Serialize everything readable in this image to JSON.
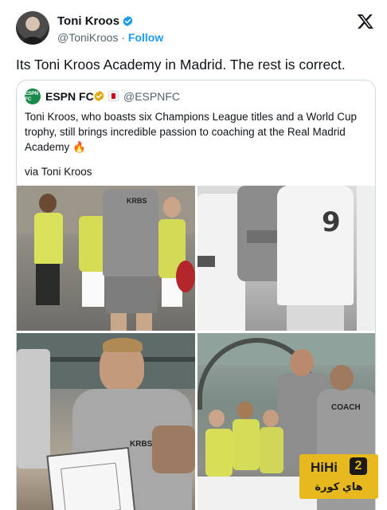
{
  "tweet": {
    "author_name": "Toni Kroos",
    "author_handle": "@ToniKroos",
    "separator": "·",
    "follow_label": "Follow",
    "text": "Its Toni Kroos Academy in Madrid. The rest is correct."
  },
  "quoted_tweet": {
    "author_name": "ESPN FC",
    "logo_text": "ESPN FC",
    "author_handle": "@ESPNFC",
    "body": "Toni Kroos, who boasts six Champions League titles and a World Cup trophy, still brings incredible passion to coaching at the Real Madrid Academy 🔥",
    "via": "via Toni Kroos"
  },
  "photos": {
    "top_left_shirt": "KRBS",
    "top_right_number": "9",
    "bottom_left_shirt": "KRBS",
    "bottom_right_shirt": "COACH"
  },
  "watermark": {
    "brand": "HiHi",
    "number": "2",
    "arabic": "هاي كورة"
  },
  "colors": {
    "verified_blue": "#1d9bf0",
    "espn_green": "#1a8a4a",
    "gold_badge": "#e0a800",
    "watermark_yellow": "#e8b81f",
    "border": "#cfd9de",
    "secondary_text": "#536471"
  },
  "icons": {
    "verified": "verified-badge-icon",
    "platform": "x-logo-icon",
    "quote_badge": "gold-checkmark-badge-icon",
    "flag": "flag-icon"
  }
}
